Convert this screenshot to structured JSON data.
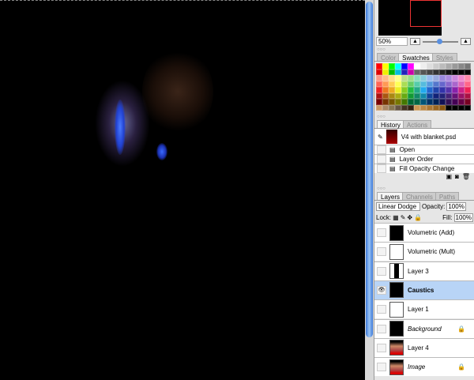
{
  "navigator": {
    "zoom": "50%"
  },
  "swatches": {
    "tabs": [
      "Color",
      "Swatches",
      "Styles"
    ],
    "active": 1,
    "colors": [
      "#f00",
      "#ff0",
      "#0f0",
      "#0ff",
      "#00f",
      "#f0f",
      "#fff",
      "#eee",
      "#ddd",
      "#ccc",
      "#bbb",
      "#aaa",
      "#999",
      "#888",
      "#777",
      "#d00",
      "#ee0",
      "#0b0",
      "#0bd",
      "#22b",
      "#c0a",
      "#666",
      "#555",
      "#444",
      "#333",
      "#222",
      "#111",
      "#000",
      "#000",
      "#000",
      "#f98",
      "#fb8",
      "#fd8",
      "#ff8",
      "#bd8",
      "#9d8",
      "#8db",
      "#8cd",
      "#9be",
      "#9ad",
      "#98d",
      "#a8d",
      "#c8d",
      "#e8c",
      "#f8a",
      "#f65",
      "#f95",
      "#fc5",
      "#ff5",
      "#ad5",
      "#6c6",
      "#5ca",
      "#5bd",
      "#59d",
      "#57c",
      "#66c",
      "#86c",
      "#a6c",
      "#d6b",
      "#f68",
      "#e22",
      "#e72",
      "#ea2",
      "#ee2",
      "#8c2",
      "#2b4",
      "#2a8",
      "#2ae",
      "#26c",
      "#24a",
      "#33a",
      "#53a",
      "#82a",
      "#c28",
      "#e25",
      "#a11",
      "#a51",
      "#a81",
      "#aa1",
      "#6a1",
      "#193",
      "#186",
      "#18a",
      "#149",
      "#127",
      "#227",
      "#427",
      "#617",
      "#916",
      "#a14",
      "#700",
      "#730",
      "#750",
      "#770",
      "#470",
      "#063",
      "#064",
      "#057",
      "#036",
      "#025",
      "#115",
      "#315",
      "#405",
      "#604",
      "#702",
      "#c96",
      "#a86",
      "#875",
      "#654",
      "#432",
      "#321",
      "#c95",
      "#b84",
      "#a73",
      "#962",
      "#851",
      "#000",
      "#000",
      "#000",
      "#000"
    ]
  },
  "history": {
    "tabs": [
      "History",
      "Actions"
    ],
    "snapshot": "V4 with blanket.psd",
    "items": [
      "Open",
      "Layer Order",
      "Fill Opacity Change"
    ]
  },
  "layers": {
    "tabs": [
      "Layers",
      "Channels",
      "Paths"
    ],
    "blend_mode": "Linear Dodge",
    "opacity_label": "Opacity:",
    "opacity": "100%",
    "lock_label": "Lock:",
    "fill_label": "Fill:",
    "fill": "100%",
    "items": [
      {
        "name": "Volumetric (Add)",
        "thumb": "black",
        "visible": false
      },
      {
        "name": "Volumetric (Mult)",
        "thumb": "white",
        "visible": false
      },
      {
        "name": "Layer 3",
        "thumb": "silhouette",
        "visible": false
      },
      {
        "name": "Caustics",
        "thumb": "black",
        "visible": true,
        "selected": true
      },
      {
        "name": "Layer 1",
        "thumb": "white",
        "visible": false
      },
      {
        "name": "Background",
        "thumb": "black",
        "visible": false,
        "locked": true,
        "italic": true
      },
      {
        "name": "Layer 4",
        "thumb": "image",
        "visible": false
      },
      {
        "name": "Image",
        "thumb": "image",
        "visible": false,
        "locked": true,
        "italic": true
      }
    ]
  }
}
